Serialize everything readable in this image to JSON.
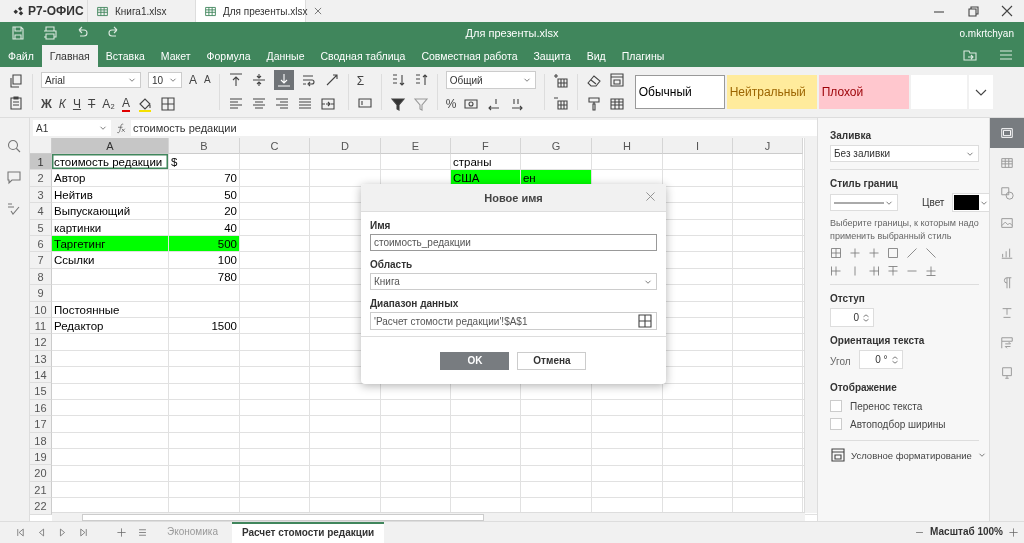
{
  "logo": "Р7-ОФИС",
  "doc_tabs": [
    {
      "label": "Книга1.xlsx",
      "selected": false
    },
    {
      "label": "Для презенты.xlsx",
      "selected": true
    }
  ],
  "title": "Для презенты.xlsx",
  "user": "o.mkrtchyan",
  "menu": [
    {
      "label": "Файл",
      "selected": false
    },
    {
      "label": "Главная",
      "selected": true
    },
    {
      "label": "Вставка",
      "selected": false
    },
    {
      "label": "Макет",
      "selected": false
    },
    {
      "label": "Формула",
      "selected": false
    },
    {
      "label": "Данные",
      "selected": false
    },
    {
      "label": "Сводная таблица",
      "selected": false
    },
    {
      "label": "Совместная работа",
      "selected": false
    },
    {
      "label": "Защита",
      "selected": false
    },
    {
      "label": "Вид",
      "selected": false
    },
    {
      "label": "Плагины",
      "selected": false
    }
  ],
  "toolbar": {
    "font": "Arial",
    "size": "10",
    "number_format": "Общий",
    "letters": [
      {
        "label": "A",
        "kind": "grow"
      },
      {
        "label": "A",
        "kind": "shrink"
      },
      {
        "label": "Ж",
        "kind": "bold"
      },
      {
        "label": "К",
        "kind": "italic"
      },
      {
        "label": "Ч",
        "kind": "underline"
      },
      {
        "label": "T",
        "kind": "strike"
      },
      {
        "label": "A₂",
        "kind": "subscript"
      },
      {
        "label": "A",
        "kind": "font-color"
      },
      {
        "label": "Σ",
        "kind": "sum"
      },
      {
        "label": "%",
        "kind": "percent"
      }
    ],
    "styles": [
      {
        "label": "Обычный",
        "kind": "normal"
      },
      {
        "label": "Нейтральный",
        "kind": "neutral"
      },
      {
        "label": "Плохой",
        "kind": "bad"
      }
    ]
  },
  "name_box": "A1",
  "formula": "стоимость редакции",
  "columns": [
    {
      "label": "A",
      "selected": true
    },
    {
      "label": "B",
      "selected": false
    },
    {
      "label": "C",
      "selected": false
    },
    {
      "label": "D",
      "selected": false
    },
    {
      "label": "E",
      "selected": false
    },
    {
      "label": "F",
      "selected": false
    },
    {
      "label": "G",
      "selected": false
    },
    {
      "label": "H",
      "selected": false
    },
    {
      "label": "I",
      "selected": false
    },
    {
      "label": "J",
      "selected": false
    }
  ],
  "rows": [
    {
      "num": "1",
      "selected": true,
      "cells": [
        {
          "text": "стоимость редакции",
          "kind": "text"
        },
        {
          "text": "$",
          "kind": "text"
        },
        {},
        {},
        {},
        {
          "text": "страны",
          "kind": "text"
        }
      ]
    },
    {
      "num": "2",
      "selected": false,
      "cells": [
        {
          "text": "Автор",
          "kind": "text"
        },
        {
          "text": "70",
          "kind": "number"
        },
        {},
        {},
        {},
        {
          "text": "США",
          "kind": "text",
          "color": "#00ff00"
        },
        {
          "text": "ен",
          "kind": "text",
          "color": "#00ff00"
        }
      ]
    },
    {
      "num": "3",
      "selected": false,
      "cells": [
        {
          "text": "Нейтив",
          "kind": "text"
        },
        {
          "text": "50",
          "kind": "number"
        }
      ]
    },
    {
      "num": "4",
      "selected": false,
      "cells": [
        {
          "text": "Выпускающий",
          "kind": "text"
        },
        {
          "text": "20",
          "kind": "number"
        }
      ]
    },
    {
      "num": "5",
      "selected": false,
      "cells": [
        {
          "text": "картинки",
          "kind": "text"
        },
        {
          "text": "40",
          "kind": "number"
        }
      ]
    },
    {
      "num": "6",
      "selected": false,
      "cells": [
        {
          "text": "Таргетинг",
          "kind": "text",
          "color": "#00ff00"
        },
        {
          "text": "500",
          "kind": "number",
          "color": "#00ff00"
        }
      ]
    },
    {
      "num": "7",
      "selected": false,
      "cells": [
        {
          "text": "Ссылки",
          "kind": "text"
        },
        {
          "text": "100",
          "kind": "number"
        }
      ]
    },
    {
      "num": "8",
      "selected": false,
      "cells": [
        {},
        {
          "text": "780",
          "kind": "number"
        }
      ]
    },
    {
      "num": "9",
      "selected": false
    },
    {
      "num": "10",
      "selected": false,
      "cells": [
        {
          "text": "Постоянные",
          "kind": "text"
        }
      ]
    },
    {
      "num": "11",
      "selected": false,
      "cells": [
        {
          "text": "Редактор",
          "kind": "text"
        },
        {
          "text": "1500",
          "kind": "number"
        }
      ]
    },
    {
      "num": "12",
      "selected": false
    },
    {
      "num": "13",
      "selected": false
    },
    {
      "num": "14",
      "selected": false
    },
    {
      "num": "15",
      "selected": false
    },
    {
      "num": "16",
      "selected": false
    },
    {
      "num": "17",
      "selected": false
    },
    {
      "num": "18",
      "selected": false
    },
    {
      "num": "19",
      "selected": false
    },
    {
      "num": "20",
      "selected": false
    },
    {
      "num": "21",
      "selected": false
    },
    {
      "num": "22",
      "selected": false
    }
  ],
  "dialog": {
    "title": "Новое имя",
    "fields": [
      {
        "label": "Имя",
        "value": "стоимость_редакции",
        "kind": "text"
      },
      {
        "label": "Область",
        "value": "Книга",
        "kind": "select"
      },
      {
        "label": "Диапазон данных",
        "value": "'Расчет стомости редакции'!$A$1",
        "kind": "range"
      }
    ],
    "buttons": [
      {
        "label": "OK",
        "kind": "primary"
      },
      {
        "label": "Отмена",
        "kind": "secondary"
      }
    ]
  },
  "panel": {
    "fill_label": "Заливка",
    "fill_value": "Без заливки",
    "border_label": "Стиль границ",
    "color_label": "Цвет",
    "border_hint": "Выберите границы, к которым надо применить выбранный стиль",
    "indent_label": "Отступ",
    "indent_value": "0",
    "orientation_label": "Ориентация текста",
    "angle_label": "Угол",
    "angle_value": "0 °",
    "display_label": "Отображение",
    "options": [
      {
        "label": "Перенос текста",
        "checked": false
      },
      {
        "label": "Автоподбор ширины",
        "checked": false
      }
    ],
    "conditional": "Условное форматирование"
  },
  "rail": [
    {
      "kind": "cell",
      "selected": true
    },
    {
      "kind": "table",
      "selected": false
    },
    {
      "kind": "shape",
      "selected": false
    },
    {
      "kind": "image",
      "selected": false
    },
    {
      "kind": "chart",
      "selected": false
    },
    {
      "kind": "paragraph",
      "selected": false
    },
    {
      "kind": "text-art",
      "selected": false
    },
    {
      "kind": "pivot",
      "selected": false
    },
    {
      "kind": "slicer",
      "selected": false
    }
  ],
  "sheets": [
    {
      "label": "Экономика",
      "selected": false
    },
    {
      "label": "Расчет стомости редакции",
      "selected": true
    }
  ],
  "zoom": "Масштаб 100%"
}
